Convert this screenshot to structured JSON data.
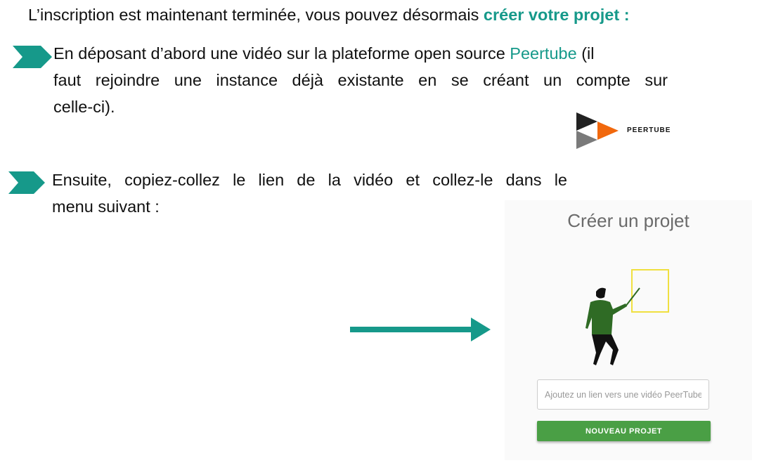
{
  "intro": {
    "text": "L’inscription est maintenant terminée, vous pouvez désormais ",
    "highlight": "créer votre projet :"
  },
  "step1": {
    "text_before": "En déposant d’abord une vidéo sur la plateforme open source ",
    "link": "Peertube",
    "text_line1_after": " (il",
    "line2": "faut rejoindre une instance déjà existante en se créant un compte sur",
    "line3": "celle-ci)."
  },
  "peertube_logo": {
    "label": "PEERTUBE"
  },
  "step2": {
    "line1": "Ensuite, copiez-collez le lien de la vidéo et collez-le dans le",
    "line2": "menu suivant :"
  },
  "panel": {
    "title": "Créer un projet",
    "input_placeholder": "Ajoutez un lien vers une vidéo PeerTube",
    "button_label": "NOUVEAU PROJET"
  },
  "colors": {
    "accent": "#16998a",
    "button": "#4a9f45",
    "frame": "#f0e040",
    "shirt": "#2f6b25"
  }
}
